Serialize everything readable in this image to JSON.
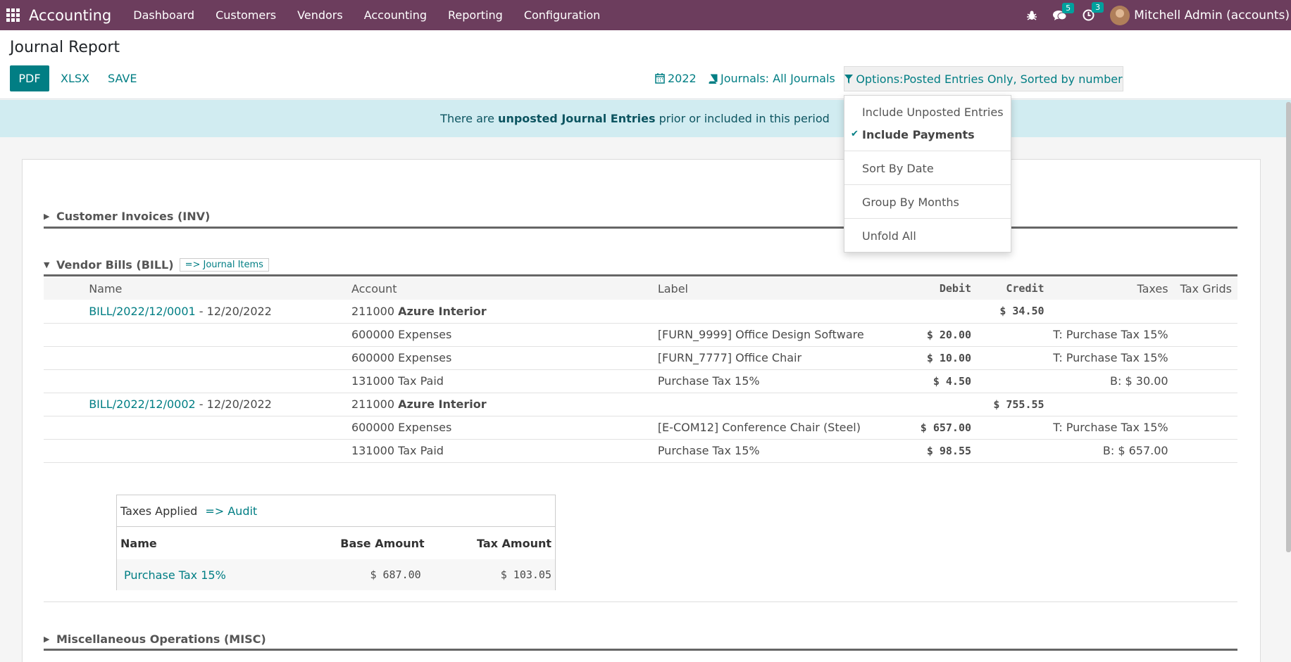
{
  "navbar": {
    "app_name": "Accounting",
    "menu": [
      "Dashboard",
      "Customers",
      "Vendors",
      "Accounting",
      "Reporting",
      "Configuration"
    ],
    "messages_count": "5",
    "activities_count": "3",
    "user": "Mitchell Admin (accounts)"
  },
  "control_panel": {
    "title": "Journal Report",
    "pdf": "PDF",
    "xlsx": "XLSX",
    "save": "SAVE",
    "period": "2022",
    "journals": "Journals: All Journals",
    "options": "Options:Posted Entries Only, Sorted by number"
  },
  "alert": {
    "prefix": "There are ",
    "bold": "unposted Journal Entries",
    "suffix": " prior or included in this period"
  },
  "options_dropdown": {
    "items": [
      "Include Unposted Entries",
      "Include Payments",
      "Sort By Date",
      "Group By Months",
      "Unfold All"
    ],
    "checked": "Include Payments"
  },
  "sections": {
    "inv": "Customer Invoices (INV)",
    "bill": "Vendor Bills (BILL)",
    "bill_link": "=> Journal Items",
    "misc": "Miscellaneous Operations (MISC)"
  },
  "columns": [
    "Name",
    "Account",
    "Label",
    "Debit",
    "Credit",
    "Taxes",
    "Tax Grids"
  ],
  "rows": [
    {
      "name": "BILL/2022/12/0001",
      "date": " - 12/20/2022",
      "acc_code": "211000 ",
      "acc_name": "Azure Interior",
      "label": "",
      "debit": "",
      "credit": "$ 34.50",
      "taxes": "",
      "grids": ""
    },
    {
      "name": "",
      "date": "",
      "acc_code": "600000 Expenses",
      "acc_name": "",
      "label": "[FURN_9999] Office Design Software",
      "debit": "$ 20.00",
      "credit": "",
      "taxes": "T: Purchase Tax 15%",
      "grids": ""
    },
    {
      "name": "",
      "date": "",
      "acc_code": "600000 Expenses",
      "acc_name": "",
      "label": "[FURN_7777] Office Chair",
      "debit": "$ 10.00",
      "credit": "",
      "taxes": "T: Purchase Tax 15%",
      "grids": ""
    },
    {
      "name": "",
      "date": "",
      "acc_code": "131000 Tax Paid",
      "acc_name": "",
      "label": "Purchase Tax 15%",
      "debit": "$ 4.50",
      "credit": "",
      "taxes": "B: $ 30.00",
      "grids": ""
    },
    {
      "name": "BILL/2022/12/0002",
      "date": " - 12/20/2022",
      "acc_code": "211000 ",
      "acc_name": "Azure Interior",
      "label": "",
      "debit": "",
      "credit": "$ 755.55",
      "taxes": "",
      "grids": ""
    },
    {
      "name": "",
      "date": "",
      "acc_code": "600000 Expenses",
      "acc_name": "",
      "label": "[E-COM12] Conference Chair (Steel)",
      "debit": "$ 657.00",
      "credit": "",
      "taxes": "T: Purchase Tax 15%",
      "grids": ""
    },
    {
      "name": "",
      "date": "",
      "acc_code": "131000 Tax Paid",
      "acc_name": "",
      "label": "Purchase Tax 15%",
      "debit": "$ 98.55",
      "credit": "",
      "taxes": "B: $ 657.00",
      "grids": ""
    }
  ],
  "taxes_applied": {
    "title": "Taxes Applied",
    "audit": "=> Audit",
    "headers": [
      "Name",
      "Base Amount",
      "Tax Amount"
    ],
    "row": {
      "name": "Purchase Tax 15%",
      "base": "$ 687.00",
      "tax": "$ 103.05"
    }
  },
  "colors": {
    "navbar": "#6c3d5d",
    "accent": "#017e84",
    "alert_bg": "#d1ecf1",
    "alert_text": "#0c5460"
  }
}
